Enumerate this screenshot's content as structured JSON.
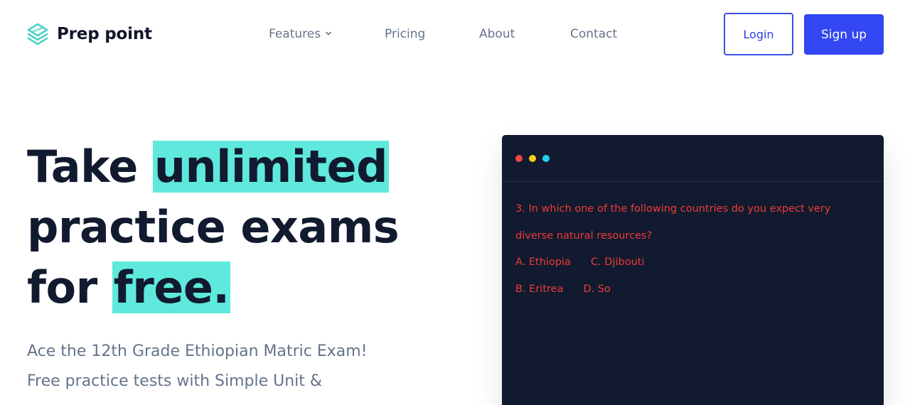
{
  "brand": {
    "name": "Prep point",
    "icon": "layers-logo-icon",
    "logo_color": "#4fd1c5"
  },
  "nav": {
    "items": [
      {
        "label": "Features",
        "has_dropdown": true
      },
      {
        "label": "Pricing"
      },
      {
        "label": "About"
      },
      {
        "label": "Contact"
      }
    ]
  },
  "auth": {
    "login_label": "Login",
    "signup_label": "Sign up"
  },
  "hero": {
    "title_parts": {
      "line1_plain": "Take ",
      "line1_highlight": "unlimited",
      "line2": "practice exams",
      "line3_plain": "for ",
      "line3_highlight": "free."
    },
    "subtitle_lines": [
      "Ace the 12th Grade Ethiopian Matric Exam!",
      "Free practice tests with Simple Unit &"
    ]
  },
  "quiz_window": {
    "dots": [
      "#ef4444",
      "#facc15",
      "#22d3ee"
    ],
    "question_lines": [
      "3. In which one of the following countries do you expect very",
      "diverse natural resources?"
    ],
    "options_row1": [
      "A. Ethiopia",
      "C. Djibouti"
    ],
    "options_row2": [
      "B. Eritrea",
      "D. So"
    ]
  },
  "colors": {
    "accent": "#3347f2",
    "highlight": "#5ee9dc",
    "dark": "#111a2e",
    "quiz_text": "#ef3b3b"
  }
}
